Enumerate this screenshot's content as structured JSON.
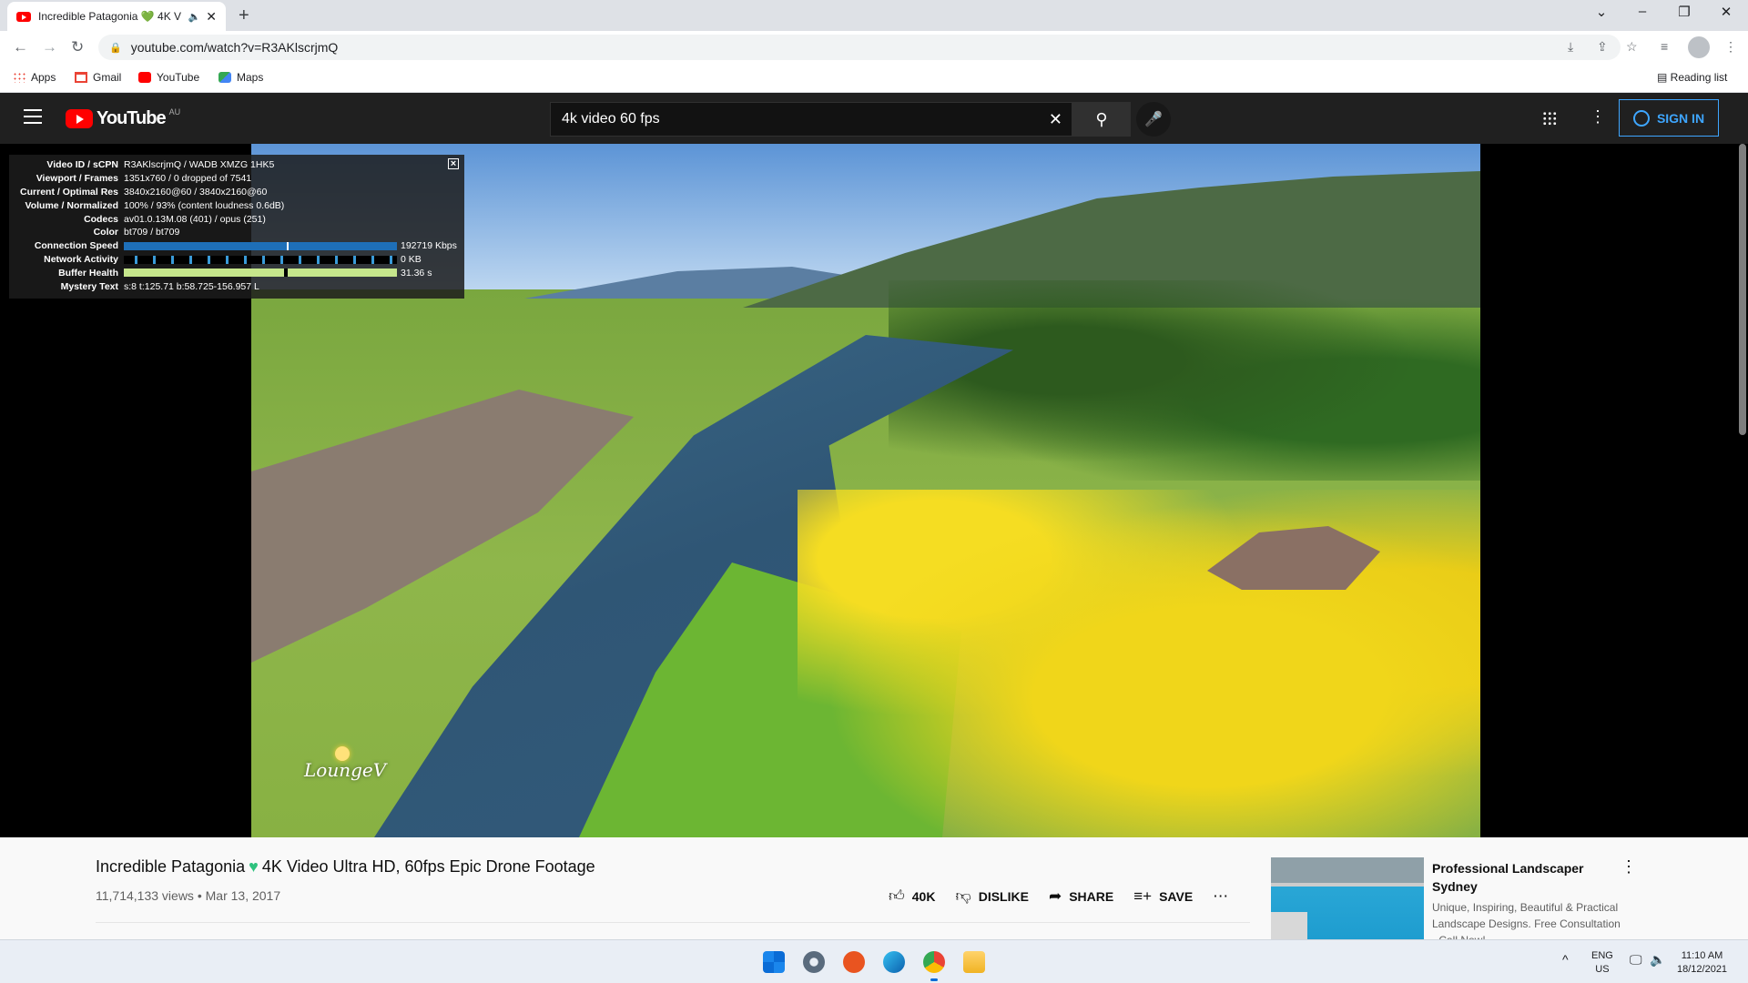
{
  "browser": {
    "tab_title": "Incredible Patagonia 💚 4K V",
    "url": "youtube.com/watch?v=R3AKlscrjmQ",
    "bookmarks": [
      "Apps",
      "Gmail",
      "YouTube",
      "Maps"
    ],
    "reading_list": "Reading list"
  },
  "youtube": {
    "logo_text": "YouTube",
    "region": "AU",
    "search_query": "4k video 60 fps",
    "sign_in": "SIGN IN"
  },
  "stats": {
    "rows": [
      {
        "k": "Video ID / sCPN",
        "v": "R3AKlscrjmQ / WADB XMZG 1HK5"
      },
      {
        "k": "Viewport / Frames",
        "v": "1351x760 / 0 dropped of 7541"
      },
      {
        "k": "Current / Optimal Res",
        "v": "3840x2160@60 / 3840x2160@60"
      },
      {
        "k": "Volume / Normalized",
        "v": "100% / 93% (content loudness 0.6dB)"
      },
      {
        "k": "Codecs",
        "v": "av01.0.13M.08 (401) / opus (251)"
      },
      {
        "k": "Color",
        "v": "bt709 / bt709"
      },
      {
        "k": "Connection Speed",
        "v": "192719 Kbps"
      },
      {
        "k": "Network Activity",
        "v": "0 KB"
      },
      {
        "k": "Buffer Health",
        "v": "31.36 s"
      },
      {
        "k": "Mystery Text",
        "v": "s:8 t:125.71 b:58.725-156.957 L"
      }
    ],
    "close": "[x]"
  },
  "video": {
    "watermark": "LoungeV",
    "title_part1": "Incredible Patagonia",
    "title_part2": "4K Video Ultra HD, 60fps Epic Drone Footage",
    "views": "11,714,133 views",
    "date": "Mar 13, 2017",
    "likes": "40K",
    "dislike": "DISLIKE",
    "share": "SHARE",
    "save": "SAVE"
  },
  "recommendation": {
    "title": "Professional Landscaper Sydney",
    "description": "Unique, Inspiring, Beautiful & Practical Landscape Designs. Free Consultation - Call Now!"
  },
  "taskbar": {
    "lang": "ENG",
    "region": "US",
    "time": "11:10 AM",
    "date": "18/12/2021"
  }
}
